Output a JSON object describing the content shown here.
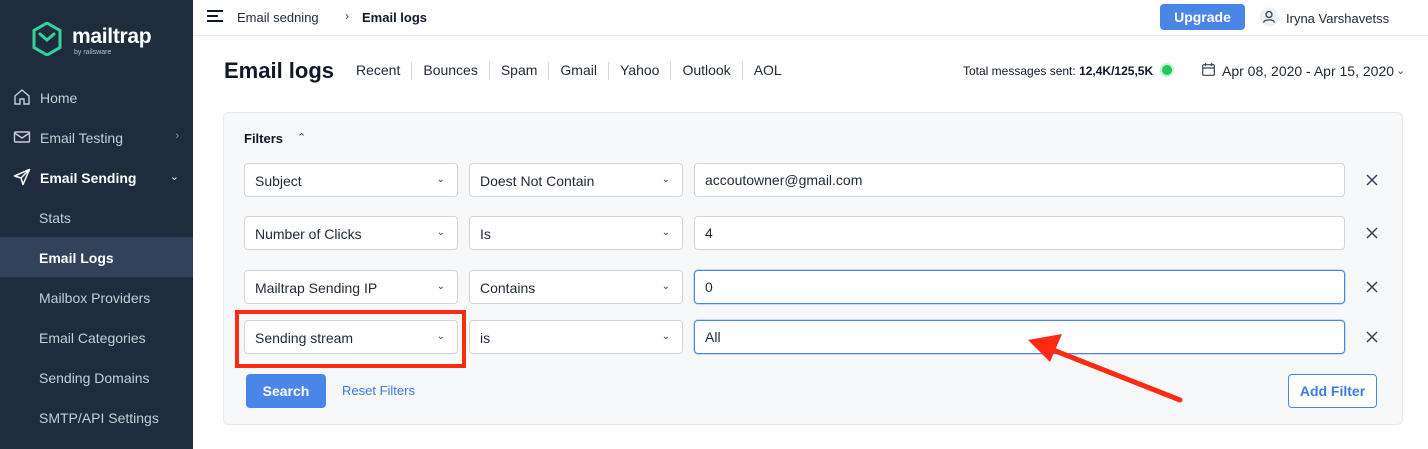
{
  "brand": {
    "name": "mailtrap",
    "sub": "by railsware"
  },
  "sidebar": {
    "items": [
      {
        "label": "Home"
      },
      {
        "label": "Email Testing"
      },
      {
        "label": "Email Sending"
      }
    ],
    "sub_items": [
      {
        "label": "Stats"
      },
      {
        "label": "Email Logs"
      },
      {
        "label": "Mailbox Providers"
      },
      {
        "label": "Email Categories"
      },
      {
        "label": "Sending Domains"
      },
      {
        "label": "SMTP/API Settings"
      }
    ]
  },
  "topbar": {
    "breadcrumb_parent": "Email sedning",
    "breadcrumb_current": "Email logs",
    "upgrade_label": "Upgrade",
    "user_name": "Iryna Varshavetss"
  },
  "header": {
    "title": "Email logs",
    "tabs": [
      "Recent",
      "Bounces",
      "Spam",
      "Gmail",
      "Yahoo",
      "Outlook",
      "AOL"
    ],
    "total_label": "Total messages sent:",
    "total_value": "12,4K/125,5K",
    "date_range": "Apr 08, 2020 - Apr 15, 2020"
  },
  "filters": {
    "title": "Filters",
    "rows": [
      {
        "field": "Subject",
        "operator": "Doest Not Contain",
        "value": "accoutowner@gmail.com"
      },
      {
        "field": "Number of Clicks",
        "operator": "Is",
        "value": "4"
      },
      {
        "field": "Mailtrap Sending IP",
        "operator": "Contains",
        "value": "0"
      },
      {
        "field": "Sending stream",
        "operator": "is",
        "value": "All"
      }
    ],
    "search_label": "Search",
    "reset_label": "Reset Filters",
    "add_label": "Add Filter"
  },
  "colors": {
    "sidebar_bg": "#1f2c3d",
    "accent": "#4a86e8",
    "status_ok": "#22c55e",
    "annotation": "#ff2a12"
  }
}
